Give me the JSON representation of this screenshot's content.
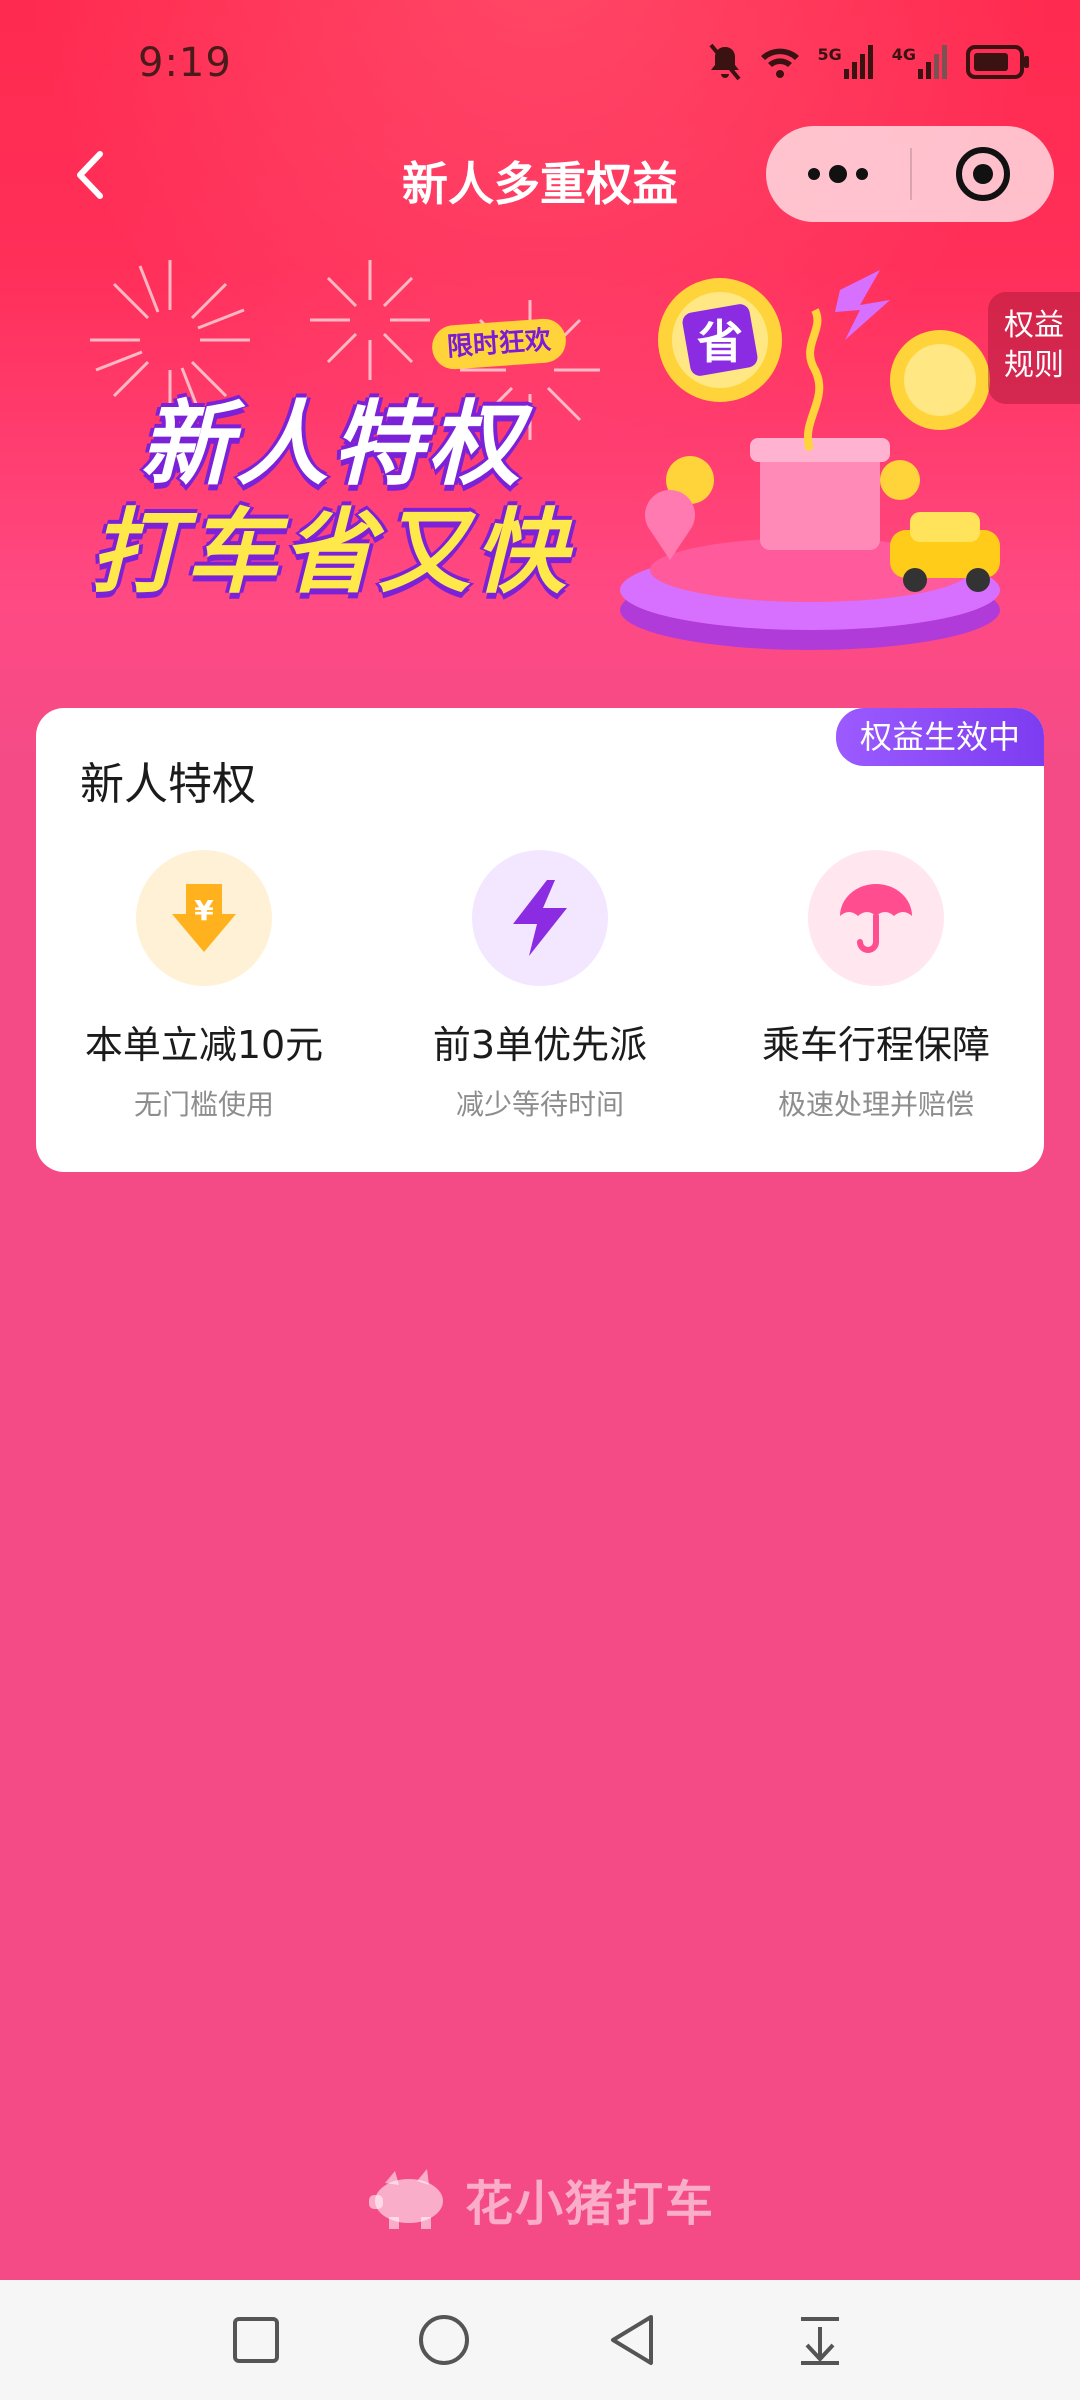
{
  "status_bar": {
    "time": "9:19",
    "network_5g": "5G",
    "network_4g": "4G"
  },
  "nav": {
    "title": "新人多重权益"
  },
  "banner": {
    "tag": "限时狂欢",
    "line1": "新人特权",
    "line2": "打车省又快",
    "rules_label_1": "权益",
    "rules_label_2": "规则",
    "coin_text": "省"
  },
  "card": {
    "title": "新人特权",
    "badge": "权益生效中",
    "perks": [
      {
        "title": "本单立减10元",
        "subtitle": "无门槛使用",
        "icon": "yen-arrow-down-icon"
      },
      {
        "title": "前3单优先派",
        "subtitle": "减少等待时间",
        "icon": "lightning-icon"
      },
      {
        "title": "乘车行程保障",
        "subtitle": "极速处理并赔偿",
        "icon": "umbrella-icon"
      }
    ]
  },
  "brand": {
    "name": "花小猪打车"
  },
  "colors": {
    "accent_pink": "#f44b86",
    "accent_red": "#ff2a4f",
    "purple": "#7d3cf0",
    "yellow": "#ffd43a"
  }
}
